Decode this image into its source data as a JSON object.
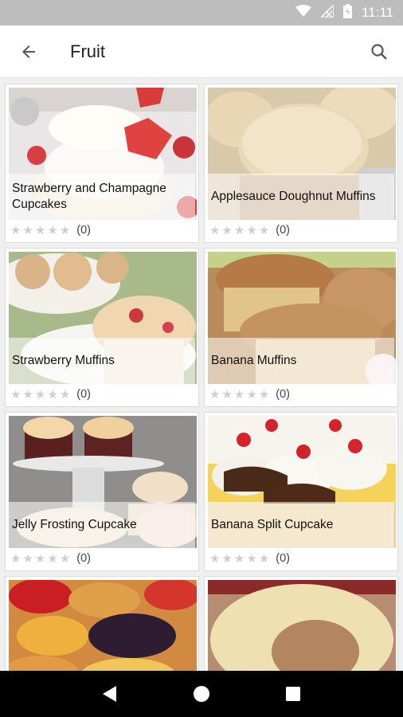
{
  "status_bar": {
    "time": "11:11"
  },
  "app_bar": {
    "title": "Fruit"
  },
  "recipes": [
    {
      "title": "Strawberry and Champagne Cupcakes",
      "rating_count": "(0)"
    },
    {
      "title": "Applesauce Doughnut Muffins",
      "rating_count": "(0)"
    },
    {
      "title": "Strawberry Muffins",
      "rating_count": "(0)"
    },
    {
      "title": "Banana Muffins",
      "rating_count": "(0)"
    },
    {
      "title": "Jelly Frosting Cupcake",
      "rating_count": "(0)"
    },
    {
      "title": "Banana Split Cupcake",
      "rating_count": "(0)"
    },
    {
      "title": "",
      "rating_count": ""
    },
    {
      "title": "",
      "rating_count": ""
    }
  ],
  "colors": {
    "status_bar": "#bdbdbd",
    "app_bar": "#ffffff",
    "nav_bar": "#000000",
    "star_empty": "#cfcfcf"
  },
  "icons": [
    "back-arrow-icon",
    "search-icon",
    "wifi-icon",
    "signal-icon",
    "battery-icon",
    "back-triangle-icon",
    "home-circle-icon",
    "recents-square-icon"
  ]
}
